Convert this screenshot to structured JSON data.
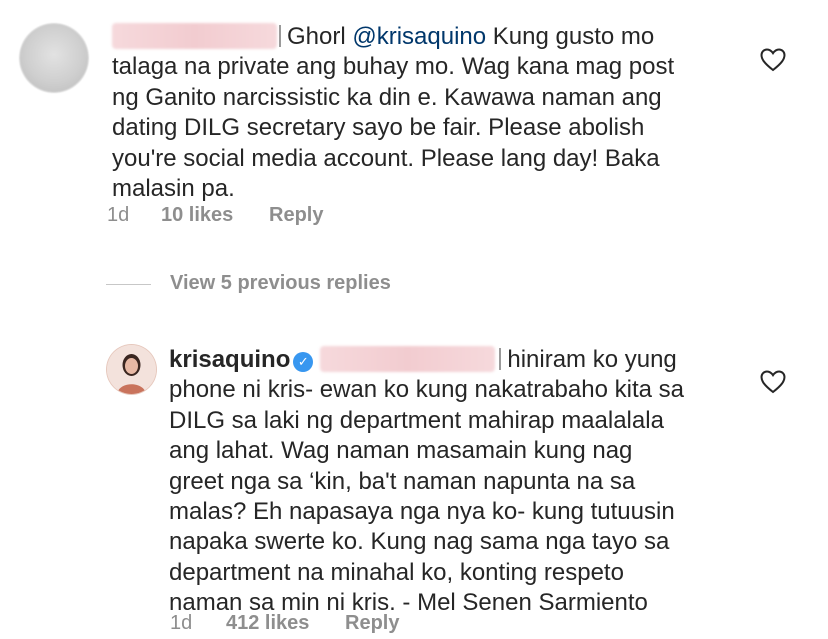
{
  "comment1": {
    "text_after_redaction": "Ghorl ",
    "mention": "@krisaquino",
    "text_rest": " Kung gusto mo\ntalaga na private ang buhay mo. Wag kana mag post\nng Ganito narcissistic ka din e. Kawawa naman ang\ndating DILG secretary sayo be fair. Please abolish\nyou're social media account. Please lang day! Baka\nmalasin pa.",
    "time": "1d",
    "likes": "10 likes",
    "reply": "Reply"
  },
  "view_replies": "View 5 previous replies",
  "comment2": {
    "username": "krisaquino",
    "text_first": "hiniram ko yung",
    "text_rest": "phone ni kris- ewan ko kung nakatrabaho kita sa\nDILG sa laki ng department mahirap maalalala\nang lahat. Wag naman masamain kung nag\ngreet nga sa ‘kin, ba't naman napunta na sa\nmalas? Eh napasaya nga nya ko- kung tutuusin\nnapaka swerte ko. Kung nag sama nga tayo sa\ndepartment na minahal ko, konting respeto\nnaman sa min ni kris. - Mel Senen Sarmiento",
    "time": "1d",
    "likes": "412 likes",
    "reply": "Reply"
  },
  "icons": {
    "like": "heart-outline-icon",
    "verified": "verified-badge-icon"
  },
  "colors": {
    "text": "#262626",
    "meta": "#8e8e8e",
    "mention": "#00376b",
    "verified": "#3897f0"
  }
}
